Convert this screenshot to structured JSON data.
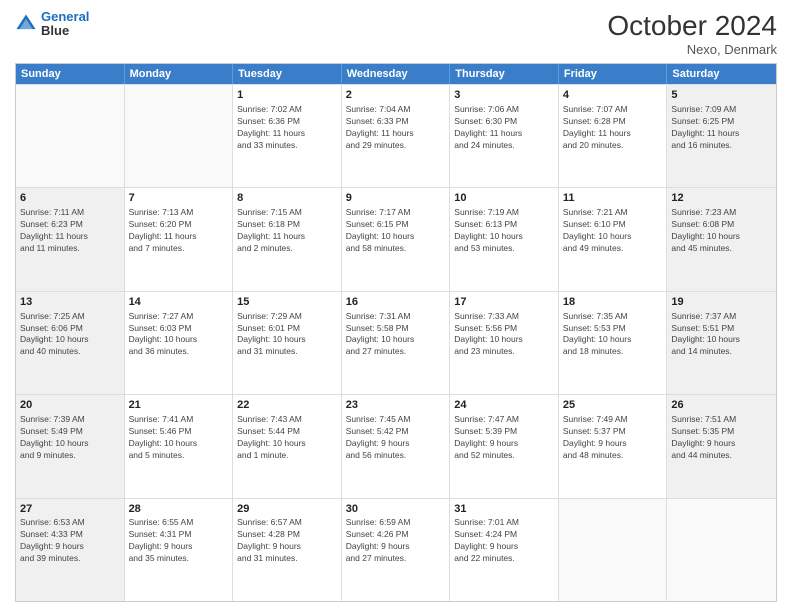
{
  "header": {
    "logo_line1": "General",
    "logo_line2": "Blue",
    "month": "October 2024",
    "location": "Nexo, Denmark"
  },
  "days_of_week": [
    "Sunday",
    "Monday",
    "Tuesday",
    "Wednesday",
    "Thursday",
    "Friday",
    "Saturday"
  ],
  "rows": [
    [
      {
        "day": "",
        "info": "",
        "empty": true
      },
      {
        "day": "",
        "info": "",
        "empty": true
      },
      {
        "day": "1",
        "info": "Sunrise: 7:02 AM\nSunset: 6:36 PM\nDaylight: 11 hours\nand 33 minutes.",
        "shaded": false
      },
      {
        "day": "2",
        "info": "Sunrise: 7:04 AM\nSunset: 6:33 PM\nDaylight: 11 hours\nand 29 minutes.",
        "shaded": false
      },
      {
        "day": "3",
        "info": "Sunrise: 7:06 AM\nSunset: 6:30 PM\nDaylight: 11 hours\nand 24 minutes.",
        "shaded": false
      },
      {
        "day": "4",
        "info": "Sunrise: 7:07 AM\nSunset: 6:28 PM\nDaylight: 11 hours\nand 20 minutes.",
        "shaded": false
      },
      {
        "day": "5",
        "info": "Sunrise: 7:09 AM\nSunset: 6:25 PM\nDaylight: 11 hours\nand 16 minutes.",
        "shaded": true
      }
    ],
    [
      {
        "day": "6",
        "info": "Sunrise: 7:11 AM\nSunset: 6:23 PM\nDaylight: 11 hours\nand 11 minutes.",
        "shaded": true
      },
      {
        "day": "7",
        "info": "Sunrise: 7:13 AM\nSunset: 6:20 PM\nDaylight: 11 hours\nand 7 minutes.",
        "shaded": false
      },
      {
        "day": "8",
        "info": "Sunrise: 7:15 AM\nSunset: 6:18 PM\nDaylight: 11 hours\nand 2 minutes.",
        "shaded": false
      },
      {
        "day": "9",
        "info": "Sunrise: 7:17 AM\nSunset: 6:15 PM\nDaylight: 10 hours\nand 58 minutes.",
        "shaded": false
      },
      {
        "day": "10",
        "info": "Sunrise: 7:19 AM\nSunset: 6:13 PM\nDaylight: 10 hours\nand 53 minutes.",
        "shaded": false
      },
      {
        "day": "11",
        "info": "Sunrise: 7:21 AM\nSunset: 6:10 PM\nDaylight: 10 hours\nand 49 minutes.",
        "shaded": false
      },
      {
        "day": "12",
        "info": "Sunrise: 7:23 AM\nSunset: 6:08 PM\nDaylight: 10 hours\nand 45 minutes.",
        "shaded": true
      }
    ],
    [
      {
        "day": "13",
        "info": "Sunrise: 7:25 AM\nSunset: 6:06 PM\nDaylight: 10 hours\nand 40 minutes.",
        "shaded": true
      },
      {
        "day": "14",
        "info": "Sunrise: 7:27 AM\nSunset: 6:03 PM\nDaylight: 10 hours\nand 36 minutes.",
        "shaded": false
      },
      {
        "day": "15",
        "info": "Sunrise: 7:29 AM\nSunset: 6:01 PM\nDaylight: 10 hours\nand 31 minutes.",
        "shaded": false
      },
      {
        "day": "16",
        "info": "Sunrise: 7:31 AM\nSunset: 5:58 PM\nDaylight: 10 hours\nand 27 minutes.",
        "shaded": false
      },
      {
        "day": "17",
        "info": "Sunrise: 7:33 AM\nSunset: 5:56 PM\nDaylight: 10 hours\nand 23 minutes.",
        "shaded": false
      },
      {
        "day": "18",
        "info": "Sunrise: 7:35 AM\nSunset: 5:53 PM\nDaylight: 10 hours\nand 18 minutes.",
        "shaded": false
      },
      {
        "day": "19",
        "info": "Sunrise: 7:37 AM\nSunset: 5:51 PM\nDaylight: 10 hours\nand 14 minutes.",
        "shaded": true
      }
    ],
    [
      {
        "day": "20",
        "info": "Sunrise: 7:39 AM\nSunset: 5:49 PM\nDaylight: 10 hours\nand 9 minutes.",
        "shaded": true
      },
      {
        "day": "21",
        "info": "Sunrise: 7:41 AM\nSunset: 5:46 PM\nDaylight: 10 hours\nand 5 minutes.",
        "shaded": false
      },
      {
        "day": "22",
        "info": "Sunrise: 7:43 AM\nSunset: 5:44 PM\nDaylight: 10 hours\nand 1 minute.",
        "shaded": false
      },
      {
        "day": "23",
        "info": "Sunrise: 7:45 AM\nSunset: 5:42 PM\nDaylight: 9 hours\nand 56 minutes.",
        "shaded": false
      },
      {
        "day": "24",
        "info": "Sunrise: 7:47 AM\nSunset: 5:39 PM\nDaylight: 9 hours\nand 52 minutes.",
        "shaded": false
      },
      {
        "day": "25",
        "info": "Sunrise: 7:49 AM\nSunset: 5:37 PM\nDaylight: 9 hours\nand 48 minutes.",
        "shaded": false
      },
      {
        "day": "26",
        "info": "Sunrise: 7:51 AM\nSunset: 5:35 PM\nDaylight: 9 hours\nand 44 minutes.",
        "shaded": true
      }
    ],
    [
      {
        "day": "27",
        "info": "Sunrise: 6:53 AM\nSunset: 4:33 PM\nDaylight: 9 hours\nand 39 minutes.",
        "shaded": true
      },
      {
        "day": "28",
        "info": "Sunrise: 6:55 AM\nSunset: 4:31 PM\nDaylight: 9 hours\nand 35 minutes.",
        "shaded": false
      },
      {
        "day": "29",
        "info": "Sunrise: 6:57 AM\nSunset: 4:28 PM\nDaylight: 9 hours\nand 31 minutes.",
        "shaded": false
      },
      {
        "day": "30",
        "info": "Sunrise: 6:59 AM\nSunset: 4:26 PM\nDaylight: 9 hours\nand 27 minutes.",
        "shaded": false
      },
      {
        "day": "31",
        "info": "Sunrise: 7:01 AM\nSunset: 4:24 PM\nDaylight: 9 hours\nand 22 minutes.",
        "shaded": false
      },
      {
        "day": "",
        "info": "",
        "empty": true
      },
      {
        "day": "",
        "info": "",
        "empty": true,
        "shaded": true
      }
    ]
  ]
}
